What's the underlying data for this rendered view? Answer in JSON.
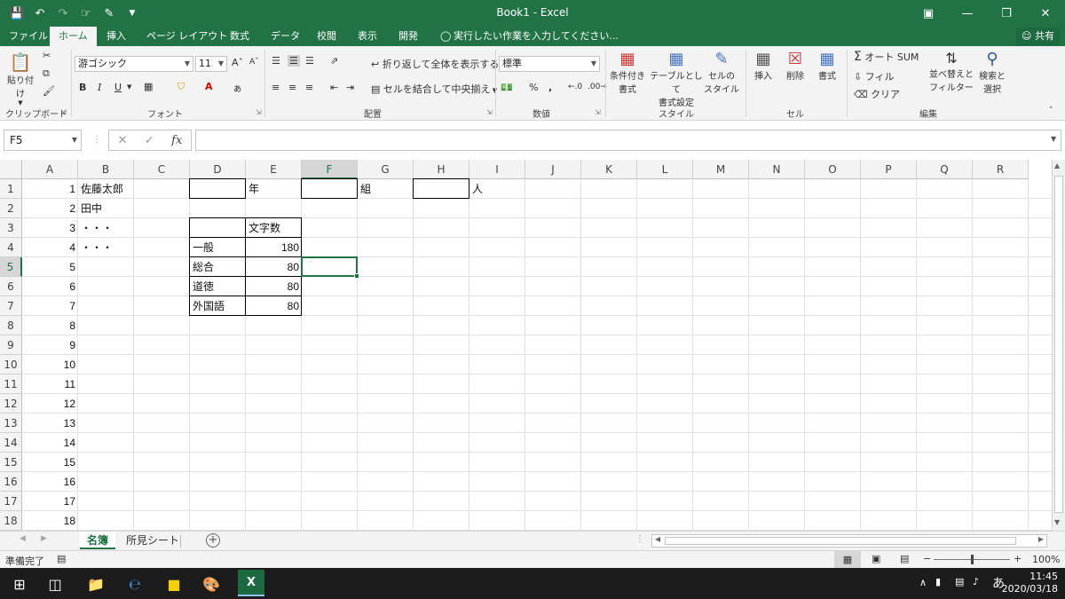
{
  "window": {
    "title": "Book1 - Excel"
  },
  "tabs": [
    "ファイル",
    "ホーム",
    "挿入",
    "ページ レイアウト",
    "数式",
    "データ",
    "校閲",
    "表示",
    "開発",
    "実行したい作業を入力してください..."
  ],
  "share_label": "共有",
  "ribbon": {
    "clipboard": {
      "paste": "貼り付け",
      "label": "クリップボード"
    },
    "font": {
      "name": "游ゴシック",
      "size": "11",
      "bold": "B",
      "italic": "I",
      "underline": "U",
      "label": "フォント"
    },
    "alignment": {
      "wrap": "折り返して全体を表示する",
      "merge": "セルを結合して中央揃え",
      "label": "配置"
    },
    "number": {
      "format": "標準",
      "label": "数値"
    },
    "styles": {
      "conditional": [
        "条件付き",
        "書式"
      ],
      "table": [
        "テーブルとして",
        "書式設定"
      ],
      "cellstyle": [
        "セルの",
        "スタイル"
      ],
      "label": "スタイル"
    },
    "cells": {
      "insert": "挿入",
      "delete": "削除",
      "format": "書式",
      "label": "セル"
    },
    "editing": {
      "autosum": "オート SUM",
      "fill": "フィル",
      "clear": "クリア",
      "sort": [
        "並べ替えと",
        "フィルター"
      ],
      "find": [
        "検索と",
        "選択"
      ],
      "label": "編集"
    }
  },
  "formula_bar": {
    "name_box": "F5",
    "formula": ""
  },
  "columns": [
    "A",
    "B",
    "C",
    "D",
    "E",
    "F",
    "G",
    "H",
    "I",
    "J",
    "K",
    "L",
    "M",
    "N",
    "O",
    "P",
    "Q",
    "R"
  ],
  "rows": [
    "1",
    "2",
    "3",
    "4",
    "5",
    "6",
    "7",
    "8",
    "9",
    "10",
    "11",
    "12",
    "13",
    "14",
    "15",
    "16",
    "17",
    "18"
  ],
  "cells": {
    "A1": "1",
    "A2": "2",
    "A3": "3",
    "A4": "4",
    "A5": "5",
    "A6": "6",
    "A7": "7",
    "A8": "8",
    "A9": "9",
    "A10": "10",
    "A11": "11",
    "A12": "12",
    "A13": "13",
    "A14": "14",
    "A15": "15",
    "A16": "16",
    "A17": "17",
    "A18": "18",
    "B1": "佐藤太郎",
    "B2": "田中",
    "B3": "・・・",
    "B4": "・・・",
    "E1": "年",
    "G1": "組",
    "I1": "人",
    "E3": "文字数",
    "D4": "一般",
    "E4": "180",
    "D5": "総合",
    "E5": "80",
    "D6": "道徳",
    "E6": "80",
    "D7": "外国語",
    "E7": "80"
  },
  "sheets": [
    "名簿",
    "所見シート"
  ],
  "status": {
    "ready": "準備完了",
    "zoom": "100%"
  },
  "tray": {
    "ime": "あ",
    "time": "11:45",
    "date": "2020/03/18"
  }
}
